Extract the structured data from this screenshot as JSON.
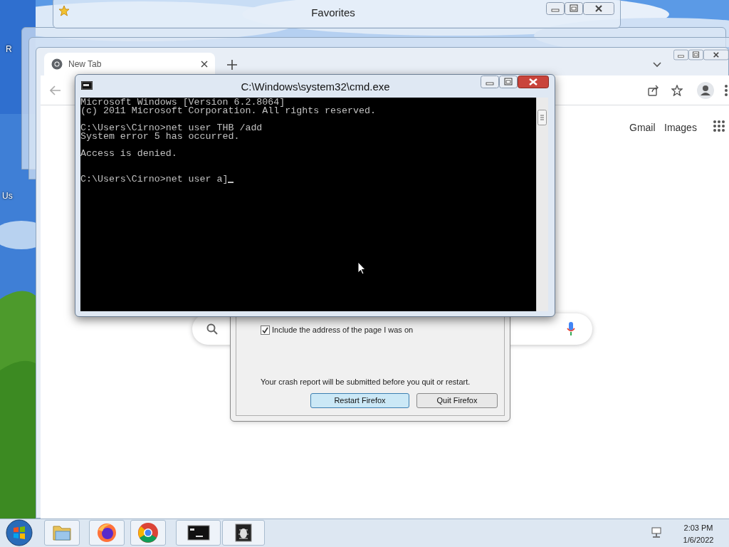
{
  "desktop_labels": [
    "R",
    "Us"
  ],
  "favorites_window": {
    "title": "Favorites"
  },
  "browser": {
    "tab": {
      "title": "New Tab",
      "selected": true
    },
    "links": [
      "Gmail",
      "Images"
    ]
  },
  "cmd": {
    "title": "C:\\Windows\\system32\\cmd.exe",
    "blocks": [
      [
        "Microsoft Windows [Version 6.2.8064]",
        "(c) 2011 Microsoft Corporation. All rights reserved."
      ],
      [
        "C:\\Users\\Cirno>net user THB /add",
        "System error 5 has occurred."
      ],
      [
        "Access is denied."
      ]
    ],
    "input": "C:\\Users\\Cirno>net user a]"
  },
  "crash_dialog": {
    "checkbox": {
      "label": "Include the address of the page I was on",
      "checked": true
    },
    "message": "Your crash report will be submitted before you quit or restart.",
    "buttons": [
      {
        "label": "Restart Firefox",
        "selected": true
      },
      {
        "label": "Quit Firefox",
        "selected": false
      }
    ]
  },
  "taskbar": {
    "apps": [
      {
        "kind": "folder"
      },
      {
        "kind": "firefox"
      },
      {
        "kind": "chrome"
      },
      {
        "kind": "console"
      },
      {
        "kind": "bug"
      }
    ],
    "time": "2:03 PM",
    "date": "1/6/2022"
  }
}
